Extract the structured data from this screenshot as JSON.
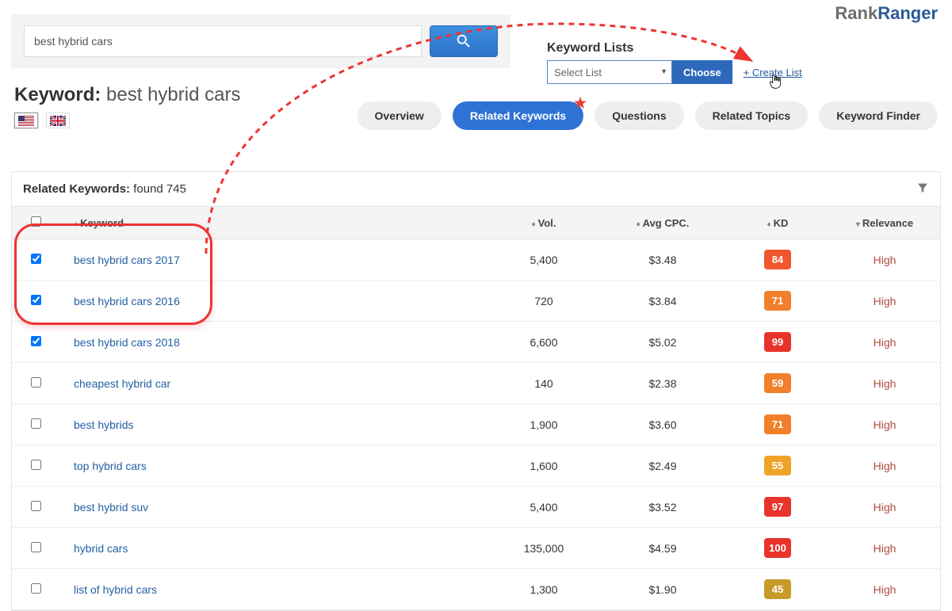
{
  "logo": {
    "part1": "Rank",
    "part2": "Ranger"
  },
  "search": {
    "value": "best hybrid cars"
  },
  "keyword_lists": {
    "label": "Keyword Lists",
    "select_placeholder": "Select List",
    "choose_btn": "Choose",
    "create_link": "+ Create List"
  },
  "heading": {
    "prefix": "Keyword:",
    "value": "best hybrid cars"
  },
  "tabs": {
    "overview": "Overview",
    "related": "Related Keywords",
    "questions": "Questions",
    "topics": "Related Topics",
    "finder": "Keyword Finder"
  },
  "panel": {
    "title_prefix": "Related Keywords:",
    "title_suffix": "found 745"
  },
  "columns": {
    "keyword": "Keyword",
    "vol": "Vol.",
    "cpc": "Avg CPC.",
    "kd": "KD",
    "relevance": "Relevance"
  },
  "rows": [
    {
      "checked": true,
      "keyword": "best hybrid cars 2017",
      "vol": "5,400",
      "cpc": "$3.48",
      "kd": "84",
      "kd_color": "#f0562f",
      "relevance": "High"
    },
    {
      "checked": true,
      "keyword": "best hybrid cars 2016",
      "vol": "720",
      "cpc": "$3.84",
      "kd": "71",
      "kd_color": "#f0802a",
      "relevance": "High"
    },
    {
      "checked": true,
      "keyword": "best hybrid cars 2018",
      "vol": "6,600",
      "cpc": "$5.02",
      "kd": "99",
      "kd_color": "#e8342b",
      "relevance": "High"
    },
    {
      "checked": false,
      "keyword": "cheapest hybrid car",
      "vol": "140",
      "cpc": "$2.38",
      "kd": "59",
      "kd_color": "#f0802a",
      "relevance": "High"
    },
    {
      "checked": false,
      "keyword": "best hybrids",
      "vol": "1,900",
      "cpc": "$3.60",
      "kd": "71",
      "kd_color": "#f0802a",
      "relevance": "High"
    },
    {
      "checked": false,
      "keyword": "top hybrid cars",
      "vol": "1,600",
      "cpc": "$2.49",
      "kd": "55",
      "kd_color": "#f0a329",
      "relevance": "High"
    },
    {
      "checked": false,
      "keyword": "best hybrid suv",
      "vol": "5,400",
      "cpc": "$3.52",
      "kd": "97",
      "kd_color": "#e8342b",
      "relevance": "High"
    },
    {
      "checked": false,
      "keyword": "hybrid cars",
      "vol": "135,000",
      "cpc": "$4.59",
      "kd": "100",
      "kd_color": "#e8342b",
      "relevance": "High"
    },
    {
      "checked": false,
      "keyword": "list of hybrid cars",
      "vol": "1,300",
      "cpc": "$1.90",
      "kd": "45",
      "kd_color": "#c79a2a",
      "relevance": "High"
    }
  ]
}
